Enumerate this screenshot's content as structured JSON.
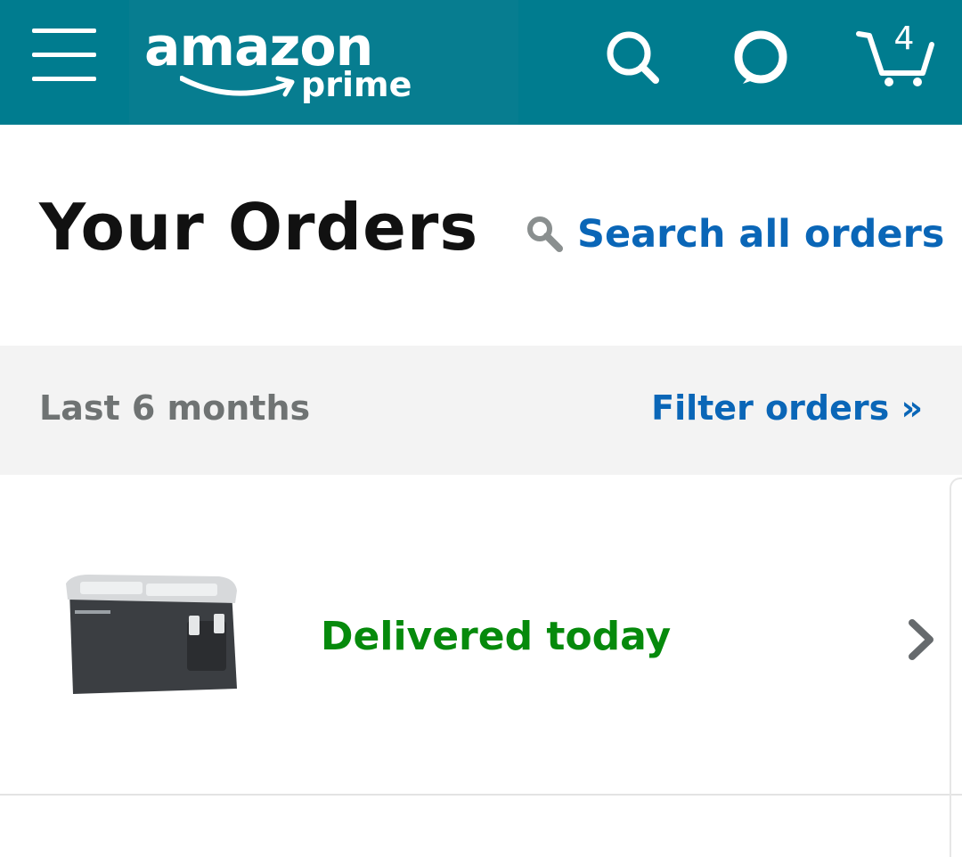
{
  "header": {
    "logo_word": "amazon",
    "logo_sub": "prime",
    "icons": [
      "menu-icon",
      "search-icon",
      "alexa-icon",
      "cart-icon"
    ],
    "cart_count": "4",
    "colors": {
      "bar": "#007c8f"
    }
  },
  "page": {
    "title": "Your Orders",
    "search_link": "Search all orders"
  },
  "filter": {
    "range": "Last 6 months",
    "link": "Filter orders »"
  },
  "orders": [
    {
      "status": "Delivered today",
      "thumbnail": "cooler-product-image"
    }
  ],
  "colors": {
    "link": "#0a66b7",
    "status_green": "#068a0c"
  }
}
